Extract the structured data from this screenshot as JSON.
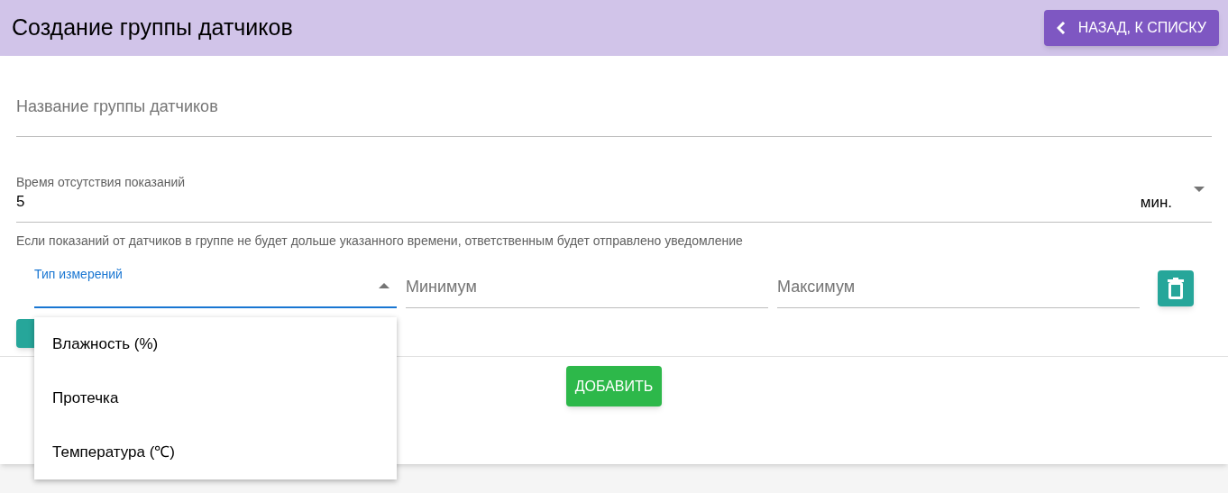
{
  "header": {
    "title": "Создание группы датчиков",
    "back_button": "НАЗАД, К СПИСКУ"
  },
  "name_field": {
    "placeholder": "Название группы датчиков"
  },
  "timeout_field": {
    "label": "Время отсутствия показаний",
    "value": "5",
    "unit": "мин.",
    "helper": "Если показаний от датчиков в группе не будет дольше указанного времени, ответственным будет отправлено уведомление"
  },
  "measurement_row": {
    "type_label": "Тип измерений",
    "type_expanded": true,
    "min_placeholder": "Минимум",
    "max_placeholder": "Максимум"
  },
  "type_options": [
    {
      "label": "Влажность (%)",
      "selected": false
    },
    {
      "label": "Протечка",
      "selected": false
    },
    {
      "label": "Температура (℃)",
      "selected": false
    }
  ],
  "submit_button": "ДОБАВИТЬ"
}
